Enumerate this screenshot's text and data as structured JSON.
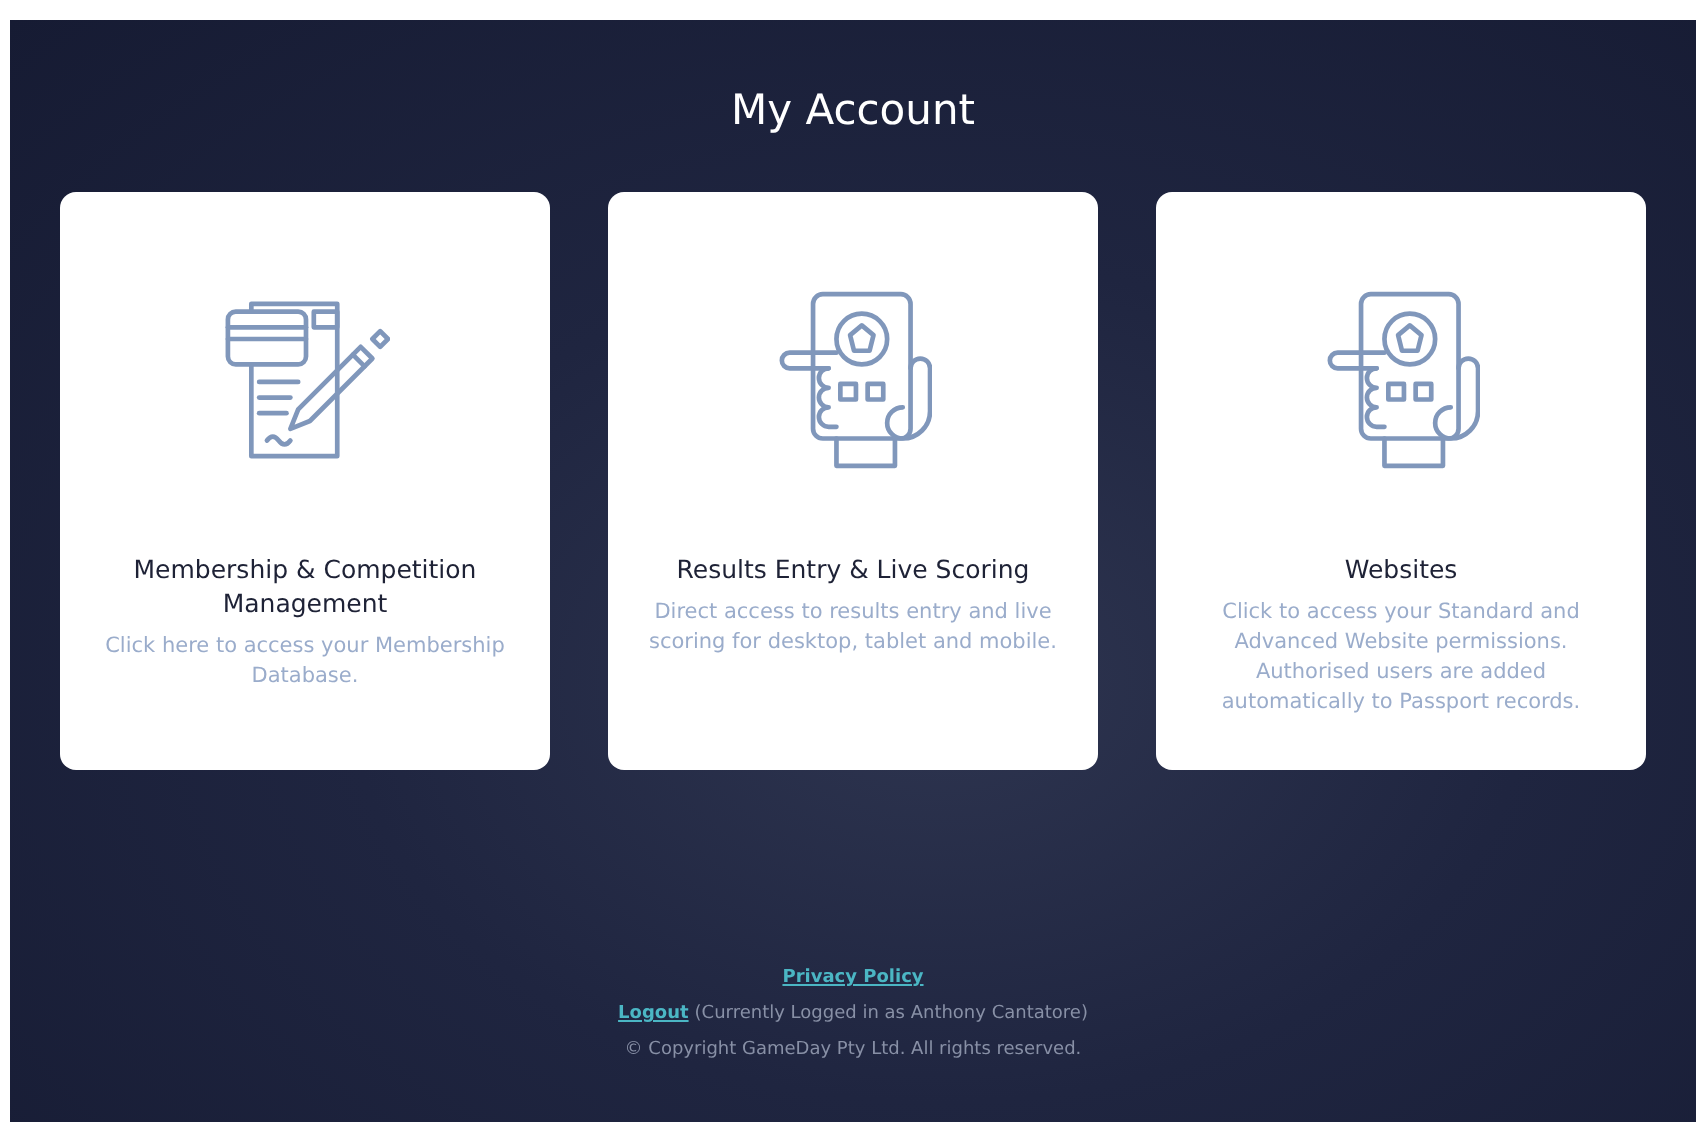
{
  "page": {
    "title": "My Account"
  },
  "cards": [
    {
      "kind": "form",
      "title": "Membership & Competition Management",
      "description": "Click here to access your Membership Database."
    },
    {
      "kind": "phone",
      "title": "Results Entry & Live Scoring",
      "description": "Direct access to results entry and live scoring for desktop, tablet and mobile."
    },
    {
      "kind": "phone",
      "title": "Websites",
      "description": "Click to access your Standard and Advanced Website permissions. Authorised users are added automatically to Passport records."
    }
  ],
  "footer": {
    "privacy_link": "Privacy Policy",
    "logout_link": "Logout",
    "login_status": "(Currently Logged in as Anthony Cantatore)",
    "copyright": "© Copyright GameDay Pty Ltd. All rights reserved."
  }
}
